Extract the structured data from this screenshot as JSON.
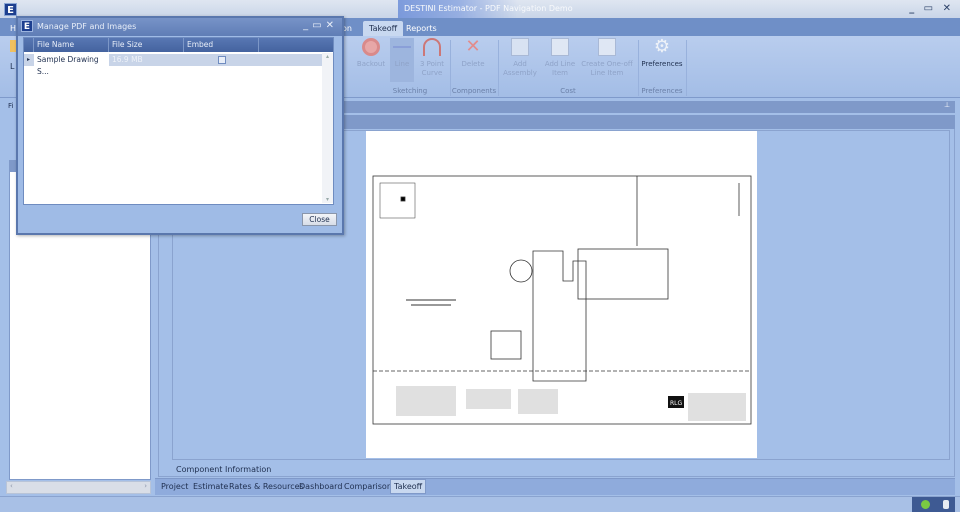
{
  "window": {
    "title": "DESTINI Estimator - PDF Navigation Demo",
    "app_icon_letter": "E",
    "controls": "_ ▭ ✕"
  },
  "ribbon": {
    "tabs": [
      {
        "label": "H"
      },
      {
        "label": "on"
      },
      {
        "label": "Takeoff",
        "selected": true
      },
      {
        "label": "Reports"
      }
    ],
    "buttons": [
      {
        "label": "Backout",
        "icon": "backout-icon",
        "group": "Sketching"
      },
      {
        "label": "Line",
        "icon": "line-icon",
        "group": "Sketching"
      },
      {
        "label": "3 Point Curve",
        "icon": "curve-icon",
        "group": "Sketching"
      },
      {
        "label": "Delete",
        "icon": "delete-icon",
        "group": "Components"
      },
      {
        "label": "Add Assembly",
        "icon": "add-assembly-icon",
        "group": "Cost"
      },
      {
        "label": "Add Line Item",
        "icon": "add-line-item-icon",
        "group": "Cost"
      },
      {
        "label": "Create One-off Line Item",
        "icon": "one-off-item-icon",
        "group": "Cost"
      },
      {
        "label": "Preferences",
        "icon": "gear-icon",
        "group": "Preferences"
      }
    ],
    "groups": [
      "Sketching",
      "Components",
      "Cost",
      "Preferences"
    ]
  },
  "left_panel": {
    "label_fragment": "Fi",
    "button_fragment": "L"
  },
  "main": {
    "component_info_label": "Component Information",
    "pin": "📌"
  },
  "bottom_tabs": [
    {
      "label": "Project"
    },
    {
      "label": "Estimate"
    },
    {
      "label": "Rates & Resources"
    },
    {
      "label": "Dashboard"
    },
    {
      "label": "Comparison"
    },
    {
      "label": "Takeoff",
      "selected": true
    }
  ],
  "dialog": {
    "title": "Manage PDF and Images",
    "columns": [
      "File Name",
      "File Size",
      "Embed"
    ],
    "rows": [
      {
        "file_name": "Sample Drawing S...",
        "file_size": "16.9 MB",
        "embed": true
      }
    ],
    "close_label": "Close"
  },
  "drawing": {
    "logo_text": "RLG"
  },
  "colors": {
    "accent": "#6f8fc7",
    "dialog_header": "#4a6aa5",
    "status_ok": "#7ac943"
  }
}
